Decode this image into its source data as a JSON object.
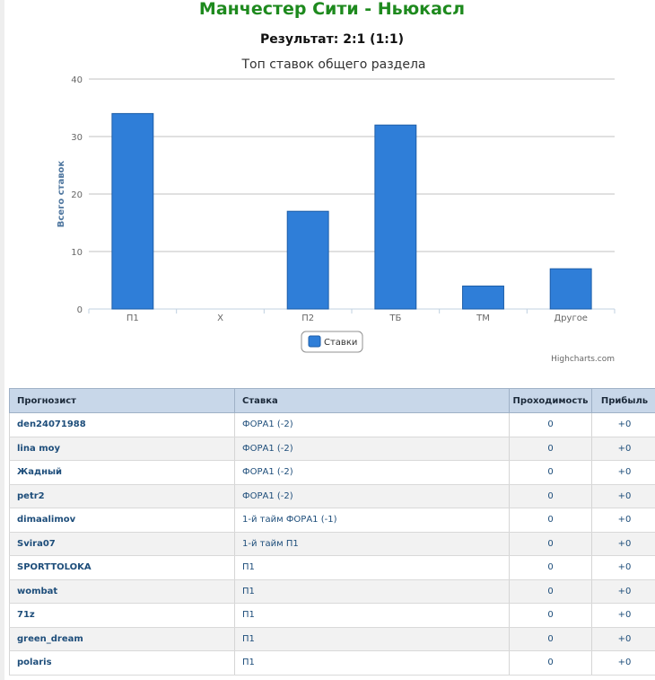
{
  "page": {
    "title": "Манчестер Сити - Ньюкасл",
    "result": "Результат: 2:1 (1:1)"
  },
  "chart_data": {
    "type": "bar",
    "title": "Топ ставок общего раздела",
    "ylabel": "Всего ставок",
    "xlabel": "",
    "categories": [
      "П1",
      "Х",
      "П2",
      "ТБ",
      "ТМ",
      "Другое"
    ],
    "series": [
      {
        "name": "Ставки",
        "values": [
          34,
          0,
          17,
          32,
          4,
          7
        ],
        "color": "#2f7ed8"
      }
    ],
    "ylim": [
      0,
      40
    ],
    "yticks": [
      0,
      10,
      20,
      30,
      40
    ],
    "grid": true,
    "legend_position": "bottom-center",
    "credit": "Highcharts.com"
  },
  "table": {
    "headers": {
      "forecaster": "Прогнозист",
      "bet": "Ставка",
      "pass_rate": "Проходимость",
      "profit": "Прибыль"
    },
    "rows": [
      {
        "user": "den24071988",
        "bet": "ФОРА1 (-2)",
        "pass_rate": "0",
        "profit": "+0"
      },
      {
        "user": "lina moy",
        "bet": "ФОРА1 (-2)",
        "pass_rate": "0",
        "profit": "+0"
      },
      {
        "user": "Жадный",
        "bet": "ФОРА1 (-2)",
        "pass_rate": "0",
        "profit": "+0"
      },
      {
        "user": "petr2",
        "bet": "ФОРА1 (-2)",
        "pass_rate": "0",
        "profit": "+0"
      },
      {
        "user": "dimaalimov",
        "bet": "1-й тайм ФОРА1 (-1)",
        "pass_rate": "0",
        "profit": "+0"
      },
      {
        "user": "Svira07",
        "bet": "1-й тайм П1",
        "pass_rate": "0",
        "profit": "+0"
      },
      {
        "user": "SPORTTOLOKA",
        "bet": "П1",
        "pass_rate": "0",
        "profit": "+0"
      },
      {
        "user": "wombat",
        "bet": "П1",
        "pass_rate": "0",
        "profit": "+0"
      },
      {
        "user": "71z",
        "bet": "П1",
        "pass_rate": "0",
        "profit": "+0"
      },
      {
        "user": "green_dream",
        "bet": "П1",
        "pass_rate": "0",
        "profit": "+0"
      },
      {
        "user": "polaris",
        "bet": "П1",
        "pass_rate": "0",
        "profit": "+0"
      }
    ]
  }
}
